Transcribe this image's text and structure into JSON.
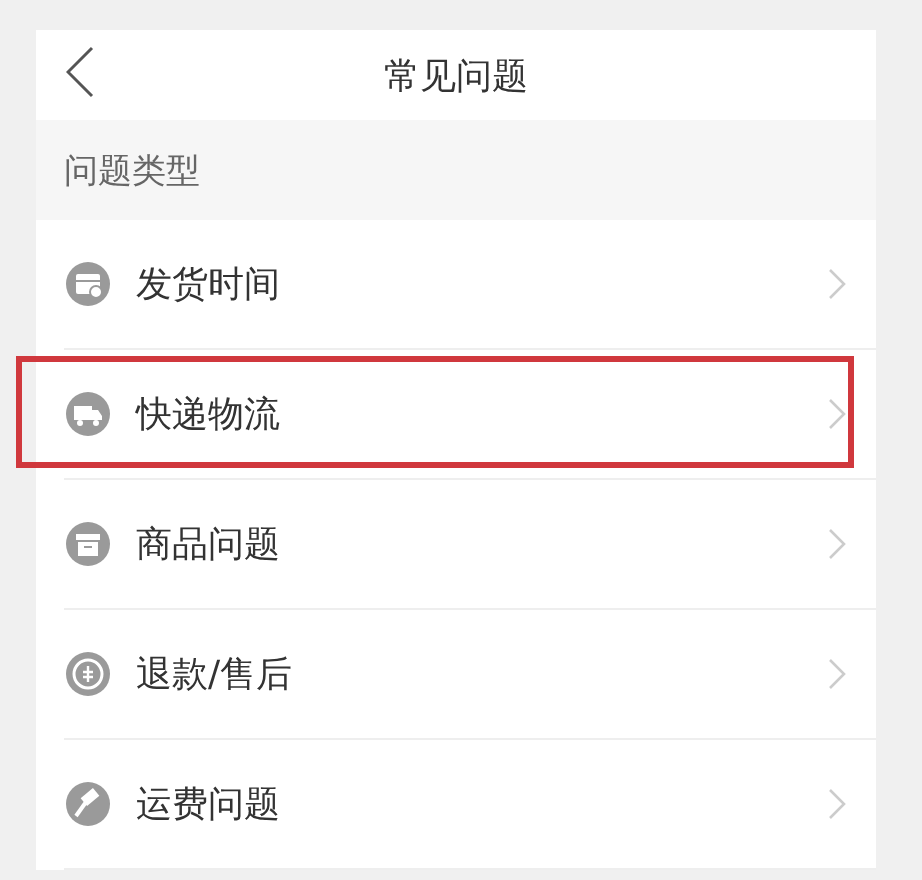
{
  "nav": {
    "title": "常见问题"
  },
  "section": {
    "title": "问题类型"
  },
  "items": [
    {
      "label": "发货时间",
      "kind": "box-clock",
      "highlighted": false
    },
    {
      "label": "快递物流",
      "kind": "truck",
      "highlighted": true
    },
    {
      "label": "商品问题",
      "kind": "box",
      "highlighted": false
    },
    {
      "label": "退款/售后",
      "kind": "coin",
      "highlighted": false
    },
    {
      "label": "运费问题",
      "kind": "hammer",
      "highlighted": false
    }
  ]
}
